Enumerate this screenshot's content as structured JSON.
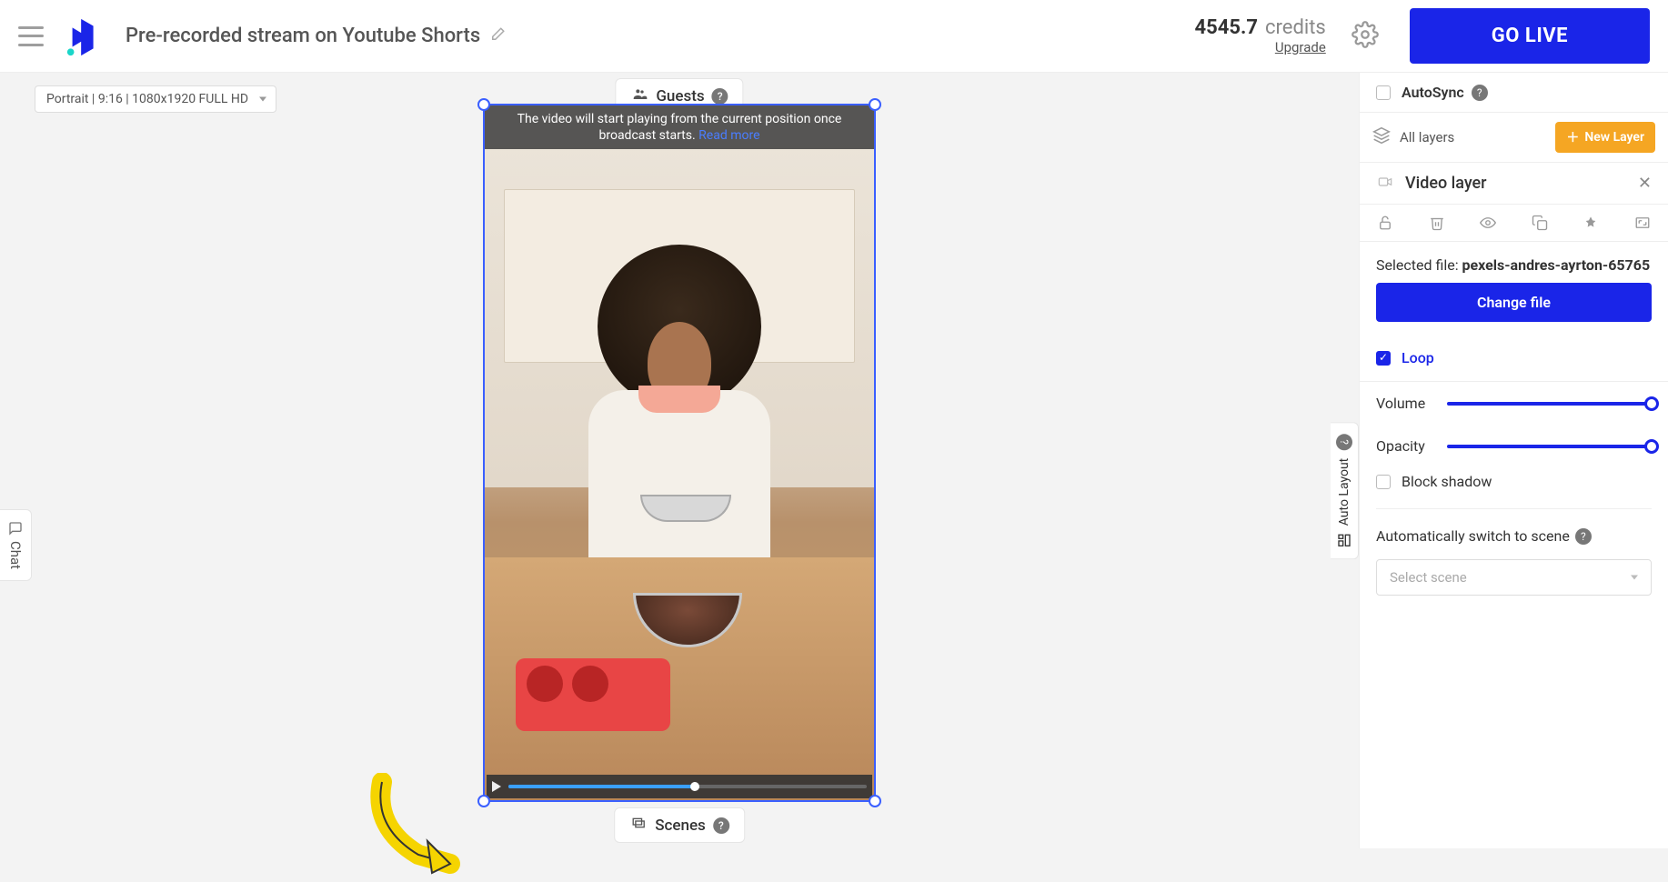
{
  "header": {
    "title": "Pre-recorded stream on Youtube Shorts",
    "credits_amount": "4545.7",
    "credits_label": "credits",
    "upgrade": "Upgrade",
    "go_live": "GO LIVE"
  },
  "canvas": {
    "format": "Portrait | 9:16 | 1080x1920 FULL HD",
    "guests_label": "Guests",
    "scenes_label": "Scenes",
    "chat_label": "Chat",
    "auto_layout_label": "Auto Layout",
    "banner_text": "The video will start playing from the current position once broadcast starts. ",
    "banner_link": "Read more"
  },
  "panel": {
    "autosync": "AutoSync",
    "all_layers": "All layers",
    "new_layer": "New Layer",
    "layer_title": "Video layer",
    "selected_file_label": "Selected file: ",
    "selected_file_name": "pexels-andres-ayrton-65765",
    "change_file": "Change file",
    "loop": "Loop",
    "volume": "Volume",
    "opacity": "Opacity",
    "block_shadow": "Block shadow",
    "auto_switch": "Automatically switch to scene",
    "select_scene": "Select scene"
  }
}
